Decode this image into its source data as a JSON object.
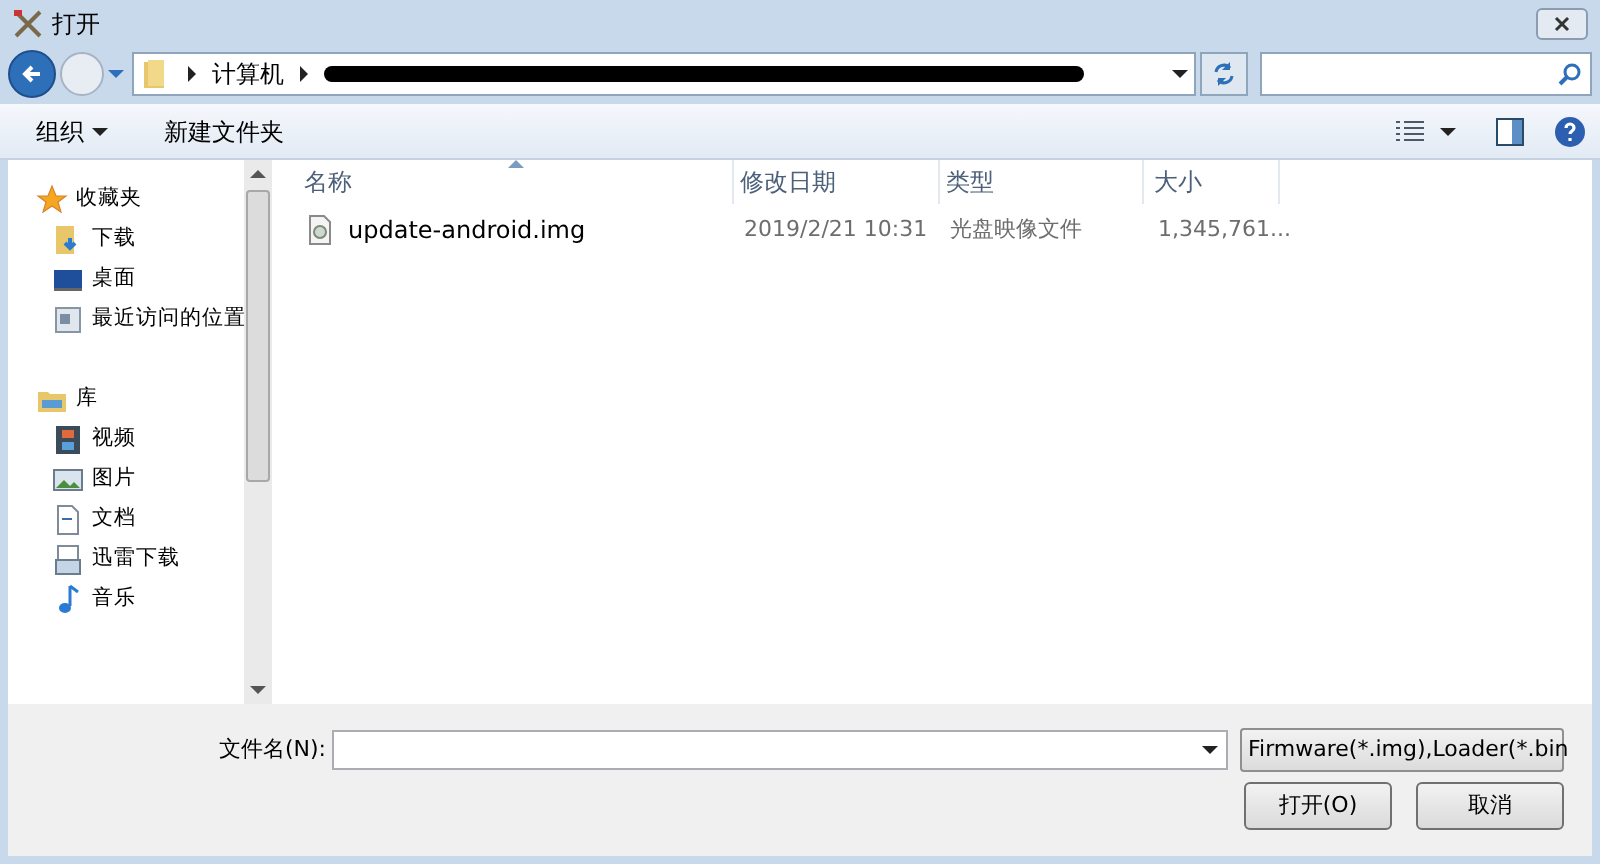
{
  "window": {
    "title": "打开"
  },
  "address": {
    "segments": [
      "计算机"
    ]
  },
  "toolbar": {
    "items": [
      {
        "label": "组织",
        "kind": "menu"
      },
      {
        "label": "新建文件夹",
        "kind": "button"
      }
    ]
  },
  "sidebar": {
    "groups": [
      {
        "label": "收藏夹",
        "kind": "star",
        "children": [
          {
            "label": "下载",
            "kind": "download"
          },
          {
            "label": "桌面",
            "kind": "desktop"
          },
          {
            "label": "最近访问的位置",
            "kind": "recent"
          }
        ]
      },
      {
        "label": "库",
        "kind": "library",
        "children": [
          {
            "label": "视频",
            "kind": "video"
          },
          {
            "label": "图片",
            "kind": "picture"
          },
          {
            "label": "文档",
            "kind": "document"
          },
          {
            "label": "迅雷下载",
            "kind": "document2"
          },
          {
            "label": "音乐",
            "kind": "music"
          }
        ]
      }
    ]
  },
  "table": {
    "columns": [
      "名称",
      "修改日期",
      "类型",
      "大小"
    ],
    "rows": [
      {
        "name": "update-android.img",
        "modified": "2019/2/21 10:31",
        "type": "光盘映像文件",
        "size": "1,345,761..."
      }
    ]
  },
  "footer": {
    "filename_label": "文件名(N):",
    "filter": "Firmware(*.img),Loader(*.bin",
    "buttons": [
      "打开(O)",
      "取消"
    ]
  }
}
